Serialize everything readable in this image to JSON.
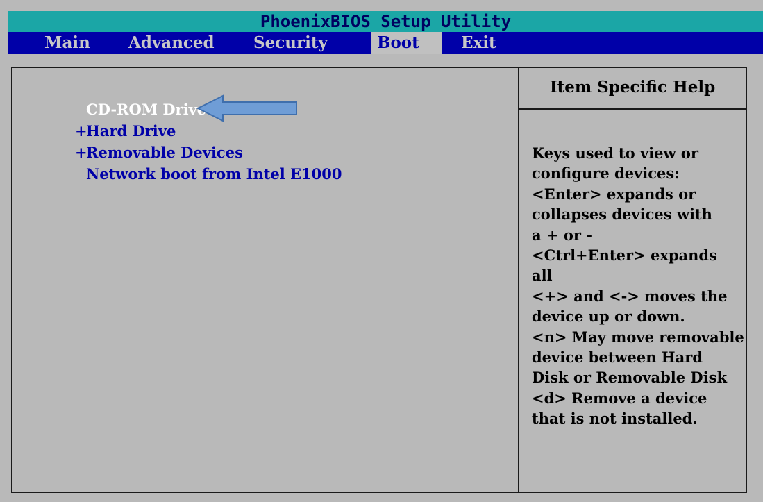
{
  "title": "PhoenixBIOS Setup Utility",
  "menu": [
    {
      "label": "Main",
      "active": false
    },
    {
      "label": "Advanced",
      "active": false
    },
    {
      "label": "Security",
      "active": false
    },
    {
      "label": "Boot",
      "active": true
    },
    {
      "label": "Exit",
      "active": false
    }
  ],
  "boot_list": [
    {
      "prefix": "",
      "label": "CD-ROM Drive",
      "selected": true
    },
    {
      "prefix": "+",
      "label": "Hard Drive",
      "selected": false
    },
    {
      "prefix": "+",
      "label": "Removable Devices",
      "selected": false
    },
    {
      "prefix": "",
      "label": "Network boot from Intel E1000",
      "selected": false
    }
  ],
  "help": {
    "title": "Item Specific Help",
    "lines": [
      "Keys used to view or",
      "configure devices:",
      "<Enter> expands or",
      "collapses devices with",
      "a + or -",
      "<Ctrl+Enter> expands",
      "all",
      "<+> and <-> moves the",
      "device up or down.",
      "<n> May move removable",
      "device between Hard",
      "Disk or Removable Disk",
      "<d> Remove a device",
      "that is not installed."
    ]
  },
  "colors": {
    "title_bar": "#1ba6a6",
    "menu_bar": "#0000a8",
    "panel_bg": "#b9b9b9",
    "item_text": "#0000a8",
    "selected_text": "#ffffff",
    "annotation_arrow": "#6f9dd6"
  }
}
